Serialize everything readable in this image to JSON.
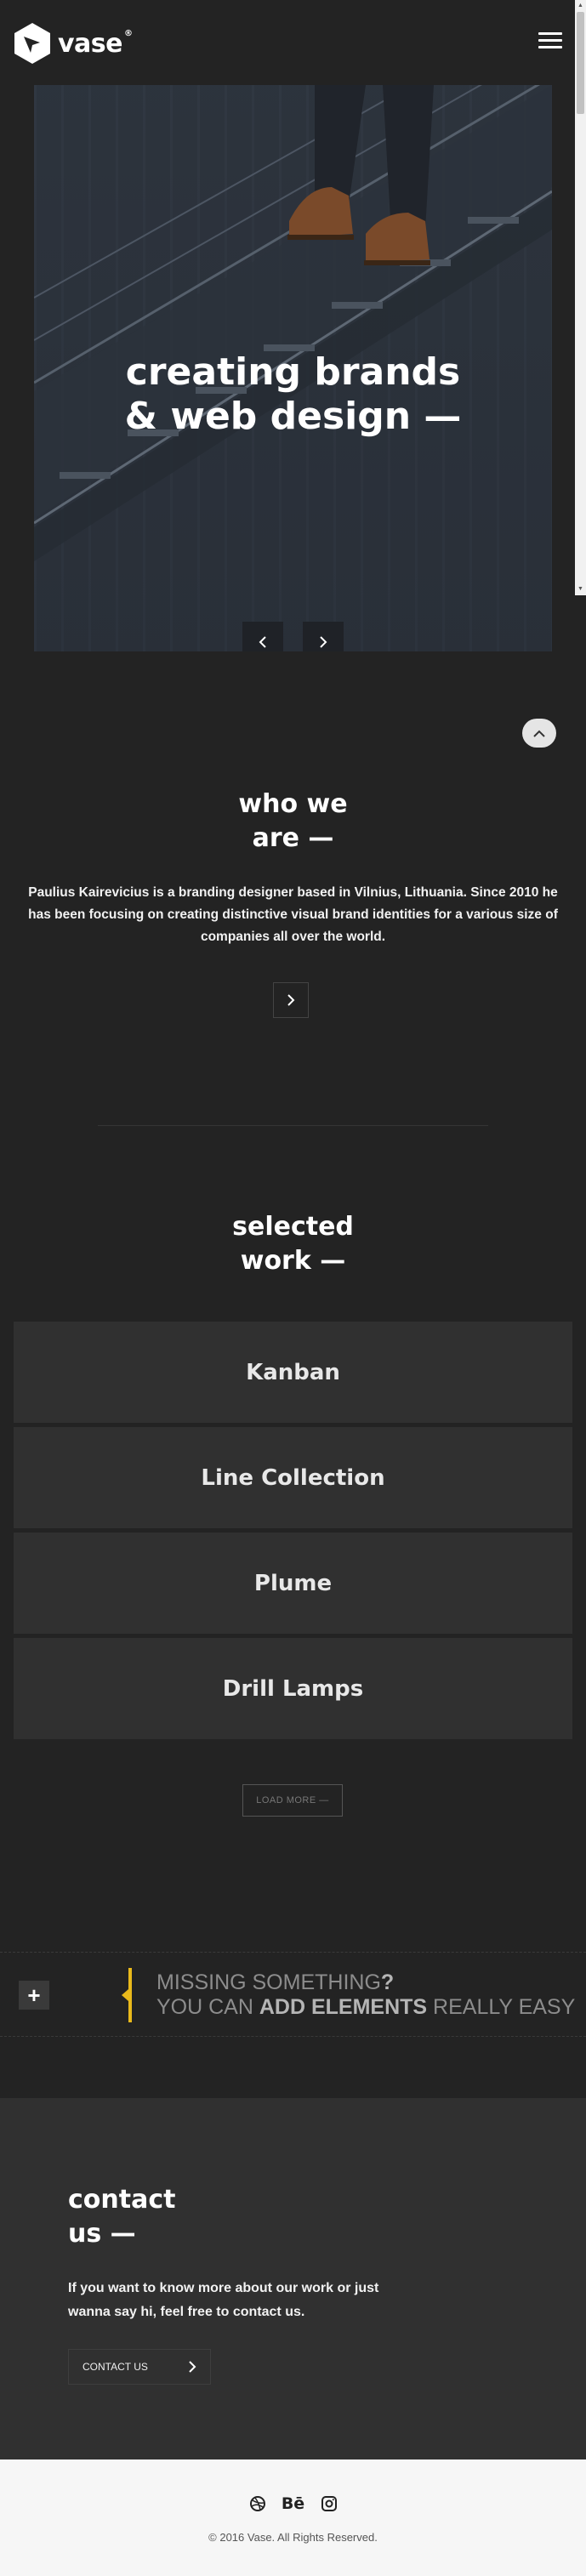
{
  "brand": {
    "name": "vase",
    "trademark": "®"
  },
  "hero": {
    "title_line1": "creating brands",
    "title_line2": "& web design —"
  },
  "about": {
    "title_line1": "who we",
    "title_line2": "are —",
    "text": "Paulius Kairevicius is a branding designer based in Vilnius, Lithuania. Since 2010 he has been focusing on creating distinctive visual brand identities for a various size of companies all over the world."
  },
  "work": {
    "title_line1": "selected",
    "title_line2": "work —",
    "items": [
      {
        "label": "Kanban"
      },
      {
        "label": "Line Collection"
      },
      {
        "label": "Plume"
      },
      {
        "label": "Drill Lamps"
      }
    ],
    "load_more": "LOAD MORE —"
  },
  "promo": {
    "line1_a": "MISSING SOMETHING",
    "line1_b": "?",
    "line2_a": "YOU CAN ",
    "line2_b": "ADD ELEMENTS",
    "line2_c": " REALLY EASY"
  },
  "contact": {
    "title_line1": "contact",
    "title_line2": "us —",
    "text": "If you want to know more about our work or just wanna say hi, feel free to contact us.",
    "button": "CONTACT US"
  },
  "footer": {
    "behance_label": "Bē",
    "copyright": "© 2016 Vase. All Rights Reserved."
  },
  "icons": {
    "menu": "hamburger-icon",
    "prev": "chevron-left-icon",
    "next": "chevron-right-icon",
    "scroll_top": "chevron-up-icon",
    "plus": "plus-icon",
    "dribbble": "dribbble-icon",
    "behance": "behance-icon",
    "instagram": "instagram-icon"
  },
  "colors": {
    "background": "#232323",
    "panel": "#303030",
    "accent": "#e9b91b",
    "footer": "#f6f6f6"
  }
}
